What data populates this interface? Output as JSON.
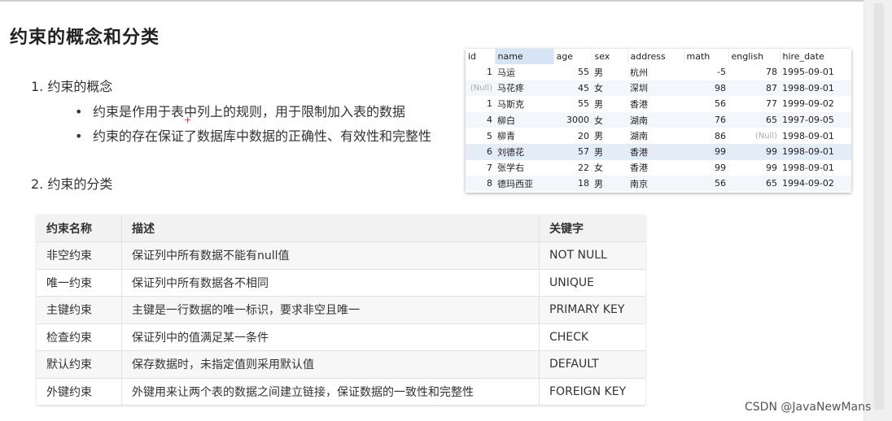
{
  "title": "约束的概念和分类",
  "section1": "1. 约束的概念",
  "bullets": [
    "约束是作用于表中列上的规则，用于限制加入表的数据",
    "约束的存在保证了数据库中数据的正确性、有效性和完整性"
  ],
  "section2": "2. 约束的分类",
  "sample_table": {
    "headers": [
      "id",
      "name",
      "age",
      "sex",
      "address",
      "math",
      "english",
      "hire_date"
    ],
    "rows": [
      [
        "1",
        "马运",
        "55",
        "男",
        "杭州",
        "-5",
        "78",
        "1995-09-01"
      ],
      [
        "(Null)",
        "马花疼",
        "45",
        "女",
        "深圳",
        "98",
        "87",
        "1998-09-01"
      ],
      [
        "1",
        "马斯克",
        "55",
        "男",
        "香港",
        "56",
        "77",
        "1999-09-02"
      ],
      [
        "4",
        "柳白",
        "3000",
        "女",
        "湖南",
        "76",
        "65",
        "1997-09-05"
      ],
      [
        "5",
        "柳青",
        "20",
        "男",
        "湖南",
        "86",
        "(Null)",
        "1998-09-01"
      ],
      [
        "6",
        "刘德花",
        "57",
        "男",
        "香港",
        "99",
        "99",
        "1998-09-01"
      ],
      [
        "7",
        "张学右",
        "22",
        "女",
        "香港",
        "99",
        "99",
        "1998-09-01"
      ],
      [
        "8",
        "德玛西亚",
        "18",
        "男",
        "南京",
        "56",
        "65",
        "1994-09-02"
      ]
    ]
  },
  "constraints": {
    "headers": [
      "约束名称",
      "描述",
      "关键字"
    ],
    "rows": [
      [
        "非空约束",
        "保证列中所有数据不能有null值",
        "NOT NULL"
      ],
      [
        "唯一约束",
        "保证列中所有数据各不相同",
        "UNIQUE"
      ],
      [
        "主键约束",
        "主键是一行数据的唯一标识，要求非空且唯一",
        "PRIMARY KEY"
      ],
      [
        "检查约束",
        "保证列中的值满足某一条件",
        "CHECK"
      ],
      [
        "默认约束",
        "保存数据时，未指定值则采用默认值",
        "DEFAULT"
      ],
      [
        "外键约束",
        "外键用来让两个表的数据之间建立链接，保证数据的一致性和完整性",
        "FOREIGN KEY"
      ]
    ]
  },
  "watermark": "CSDN @JavaNewMans"
}
